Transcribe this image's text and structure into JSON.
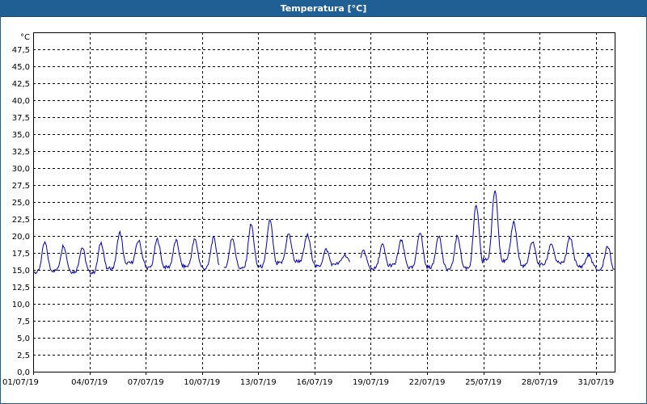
{
  "window": {
    "title": "Temperatura [°C]"
  },
  "colors": {
    "title_bar": "#1f5f93",
    "series": "#0000aa",
    "grid": "#000000",
    "background": "#ffffff"
  },
  "chart_data": {
    "type": "line",
    "title": "Temperatura [°C]",
    "ylabel": "°C",
    "xlabel": "",
    "ylim": [
      0,
      50
    ],
    "yticks": [
      "0,0",
      "2,5",
      "5,0",
      "7,5",
      "10,0",
      "12,5",
      "15,0",
      "17,5",
      "20,0",
      "22,5",
      "25,0",
      "27,5",
      "30,0",
      "32,5",
      "35,0",
      "37,5",
      "40,0",
      "42,5",
      "45,0",
      "47,5"
    ],
    "yticks_values": [
      0,
      2.5,
      5,
      7.5,
      10,
      12.5,
      15,
      17.5,
      20,
      22.5,
      25,
      27.5,
      30,
      32.5,
      35,
      37.5,
      40,
      42.5,
      45,
      47.5
    ],
    "xlim_days": [
      1,
      32
    ],
    "xticks": [
      "01/07/19",
      "04/07/19",
      "07/07/19",
      "10/07/19",
      "13/07/19",
      "16/07/19",
      "19/07/19",
      "22/07/19",
      "25/07/19",
      "28/07/19",
      "31/07/19"
    ],
    "grid": true,
    "legend": "none",
    "series": [
      {
        "daily": [
          {
            "day": 1,
            "min": 14.7,
            "max": 19.0
          },
          {
            "day": 2,
            "min": 14.9,
            "max": 18.6
          },
          {
            "day": 3,
            "min": 14.7,
            "max": 18.3
          },
          {
            "day": 4,
            "min": 14.6,
            "max": 19.0
          },
          {
            "day": 5,
            "min": 15.2,
            "max": 20.5
          },
          {
            "day": 6,
            "min": 16.0,
            "max": 19.3
          },
          {
            "day": 7,
            "min": 15.3,
            "max": 19.5
          },
          {
            "day": 8,
            "min": 15.4,
            "max": 19.3
          },
          {
            "day": 9,
            "min": 15.5,
            "max": 19.5
          },
          {
            "day": 10,
            "min": 15.2,
            "max": 19.7
          },
          {
            "day": 11,
            "min": 15.3,
            "max": 19.7
          },
          {
            "day": 12,
            "min": 15.2,
            "max": 21.7
          },
          {
            "day": 13,
            "min": 15.5,
            "max": 22.3
          },
          {
            "day": 14,
            "min": 16.0,
            "max": 20.3
          },
          {
            "day": 15,
            "min": 16.3,
            "max": 20.1
          },
          {
            "day": 16,
            "min": 15.5,
            "max": 18.0
          },
          {
            "day": 17,
            "min": 15.9,
            "max": 17.2
          },
          {
            "day": 18,
            "min": 15.1,
            "max": 17.8
          },
          {
            "day": 19,
            "min": 15.2,
            "max": 18.7
          },
          {
            "day": 20,
            "min": 15.7,
            "max": 19.3
          },
          {
            "day": 21,
            "min": 15.3,
            "max": 20.6
          },
          {
            "day": 22,
            "min": 15.4,
            "max": 20.1
          },
          {
            "day": 23,
            "min": 15.1,
            "max": 20.0
          },
          {
            "day": 24,
            "min": 15.3,
            "max": 24.5
          },
          {
            "day": 25,
            "min": 16.5,
            "max": 26.7
          },
          {
            "day": 26,
            "min": 16.3,
            "max": 22.1
          },
          {
            "day": 27,
            "min": 15.6,
            "max": 19.2
          },
          {
            "day": 28,
            "min": 15.8,
            "max": 18.9
          },
          {
            "day": 29,
            "min": 16.0,
            "max": 19.8
          },
          {
            "day": 30,
            "min": 15.5,
            "max": 17.2
          },
          {
            "day": 31,
            "min": 15.0,
            "max": 18.5
          }
        ],
        "gaps_days": [
          [
            10.95,
            11.15
          ],
          [
            17.9,
            18.45
          ]
        ]
      }
    ]
  }
}
